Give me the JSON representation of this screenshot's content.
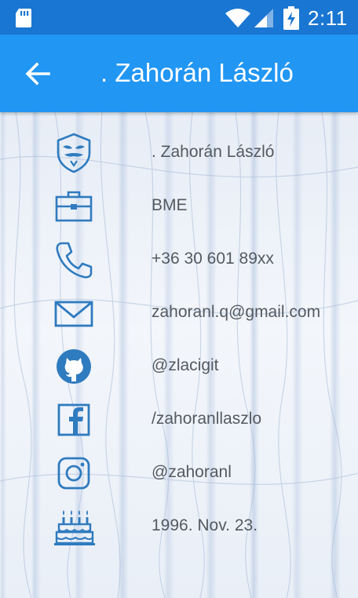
{
  "status_bar": {
    "time": "2:11",
    "icons": [
      "sd-card-icon",
      "wifi-icon",
      "signal-icon",
      "battery-charging-icon"
    ]
  },
  "app_bar": {
    "title": ". Zahorán László",
    "back_icon": "arrow-left-icon"
  },
  "colors": {
    "status_bar": "#1976d2",
    "app_bar": "#2196f3",
    "icon_stroke": "#2f7bbf",
    "label_text": "#555a60"
  },
  "profile": {
    "items": [
      {
        "icon": "anonymous-mask-icon",
        "label": ". Zahorán László"
      },
      {
        "icon": "briefcase-icon",
        "label": "BME"
      },
      {
        "icon": "phone-icon",
        "label": "+36 30 601 89xx"
      },
      {
        "icon": "envelope-icon",
        "label": "zahoranl.q@gmail.com"
      },
      {
        "icon": "github-icon",
        "label": "@zlacigit"
      },
      {
        "icon": "facebook-icon",
        "label": "/zahoranllaszlo"
      },
      {
        "icon": "instagram-icon",
        "label": "@zahoranl"
      },
      {
        "icon": "birthday-cake-icon",
        "label": "1996. Nov. 23."
      }
    ]
  }
}
